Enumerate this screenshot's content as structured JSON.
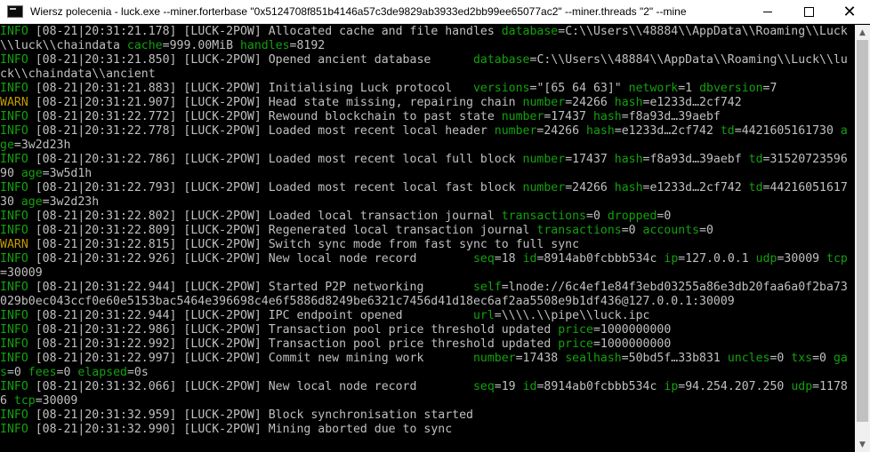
{
  "window": {
    "title": "Wiersz polecenia - luck.exe  --miner.forterbase \"0x5124708f851b4146a57c3de9829ab3933ed2bb99ee65077ac2\"  --miner.threads \"2\"  --mine",
    "controls": {
      "minimize": "—",
      "maximize": "☐",
      "close": "✕"
    }
  },
  "colors": {
    "info": "#13a10e",
    "warn": "#c19c00",
    "text": "#c0c0c0",
    "background": "#000000"
  },
  "lines": [
    [
      [
        "INFO",
        "INFO"
      ],
      [
        "t",
        " [08-21|20:31:21.178] [LUCK-2POW] Allocated cache and file handles "
      ],
      [
        "k",
        "database"
      ],
      [
        "t",
        "=C:\\\\Users\\\\48884\\\\AppData\\\\Roaming\\\\Luck"
      ]
    ],
    [
      [
        "t",
        "\\\\luck\\\\chaindata "
      ],
      [
        "k",
        "cache"
      ],
      [
        "t",
        "=999.00MiB "
      ],
      [
        "k",
        "handles"
      ],
      [
        "t",
        "=8192"
      ]
    ],
    [
      [
        "INFO",
        "INFO"
      ],
      [
        "t",
        " [08-21|20:31:21.850] [LUCK-2POW] Opened ancient database      "
      ],
      [
        "k",
        "database"
      ],
      [
        "t",
        "=C:\\\\Users\\\\48884\\\\AppData\\\\Roaming\\\\Luck\\\\lu"
      ]
    ],
    [
      [
        "t",
        "ck\\\\chaindata\\\\ancient"
      ]
    ],
    [
      [
        "INFO",
        "INFO"
      ],
      [
        "t",
        " [08-21|20:31:21.883] [LUCK-2POW] Initialising Luck protocol   "
      ],
      [
        "k",
        "versions"
      ],
      [
        "t",
        "=\"[65 64 63]\" "
      ],
      [
        "k",
        "network"
      ],
      [
        "t",
        "=1 "
      ],
      [
        "k",
        "dbversion"
      ],
      [
        "t",
        "=7"
      ]
    ],
    [
      [
        "WARN",
        "WARN"
      ],
      [
        "t",
        " [08-21|20:31:21.907] [LUCK-2POW] Head state missing, repairing chain "
      ],
      [
        "k",
        "number"
      ],
      [
        "t",
        "=24266 "
      ],
      [
        "k",
        "hash"
      ],
      [
        "t",
        "=e1233d…2cf742"
      ]
    ],
    [
      [
        "INFO",
        "INFO"
      ],
      [
        "t",
        " [08-21|20:31:22.772] [LUCK-2POW] Rewound blockchain to past state "
      ],
      [
        "k",
        "number"
      ],
      [
        "t",
        "=17437 "
      ],
      [
        "k",
        "hash"
      ],
      [
        "t",
        "=f8a93d…39aebf"
      ]
    ],
    [
      [
        "INFO",
        "INFO"
      ],
      [
        "t",
        " [08-21|20:31:22.778] [LUCK-2POW] Loaded most recent local header "
      ],
      [
        "k",
        "number"
      ],
      [
        "t",
        "=24266 "
      ],
      [
        "k",
        "hash"
      ],
      [
        "t",
        "=e1233d…2cf742 "
      ],
      [
        "k",
        "td"
      ],
      [
        "t",
        "=4421605161730 "
      ],
      [
        "k",
        "a"
      ]
    ],
    [
      [
        "k",
        "ge"
      ],
      [
        "t",
        "=3w2d23h"
      ]
    ],
    [
      [
        "INFO",
        "INFO"
      ],
      [
        "t",
        " [08-21|20:31:22.786] [LUCK-2POW] Loaded most recent local full block "
      ],
      [
        "k",
        "number"
      ],
      [
        "t",
        "=17437 "
      ],
      [
        "k",
        "hash"
      ],
      [
        "t",
        "=f8a93d…39aebf "
      ],
      [
        "k",
        "td"
      ],
      [
        "t",
        "=31520723596"
      ]
    ],
    [
      [
        "t",
        "90 "
      ],
      [
        "k",
        "age"
      ],
      [
        "t",
        "=3w5d1h"
      ]
    ],
    [
      [
        "INFO",
        "INFO"
      ],
      [
        "t",
        " [08-21|20:31:22.793] [LUCK-2POW] Loaded most recent local fast block "
      ],
      [
        "k",
        "number"
      ],
      [
        "t",
        "=24266 "
      ],
      [
        "k",
        "hash"
      ],
      [
        "t",
        "=e1233d…2cf742 "
      ],
      [
        "k",
        "td"
      ],
      [
        "t",
        "=44216051617"
      ]
    ],
    [
      [
        "t",
        "30 "
      ],
      [
        "k",
        "age"
      ],
      [
        "t",
        "=3w2d23h"
      ]
    ],
    [
      [
        "INFO",
        "INFO"
      ],
      [
        "t",
        " [08-21|20:31:22.802] [LUCK-2POW] Loaded local transaction journal "
      ],
      [
        "k",
        "transactions"
      ],
      [
        "t",
        "=0 "
      ],
      [
        "k",
        "dropped"
      ],
      [
        "t",
        "=0"
      ]
    ],
    [
      [
        "INFO",
        "INFO"
      ],
      [
        "t",
        " [08-21|20:31:22.809] [LUCK-2POW] Regenerated local transaction journal "
      ],
      [
        "k",
        "transactions"
      ],
      [
        "t",
        "=0 "
      ],
      [
        "k",
        "accounts"
      ],
      [
        "t",
        "=0"
      ]
    ],
    [
      [
        "WARN",
        "WARN"
      ],
      [
        "t",
        " [08-21|20:31:22.815] [LUCK-2POW] Switch sync mode from fast sync to full sync"
      ]
    ],
    [
      [
        "INFO",
        "INFO"
      ],
      [
        "t",
        " [08-21|20:31:22.926] [LUCK-2POW] New local node record        "
      ],
      [
        "k",
        "seq"
      ],
      [
        "t",
        "=18 "
      ],
      [
        "k",
        "id"
      ],
      [
        "t",
        "=8914ab0fcbbb534c "
      ],
      [
        "k",
        "ip"
      ],
      [
        "t",
        "=127.0.0.1 "
      ],
      [
        "k",
        "udp"
      ],
      [
        "t",
        "=30009 "
      ],
      [
        "k",
        "tcp"
      ]
    ],
    [
      [
        "t",
        "=30009"
      ]
    ],
    [
      [
        "INFO",
        "INFO"
      ],
      [
        "t",
        " [08-21|20:31:22.944] [LUCK-2POW] Started P2P networking       "
      ],
      [
        "k",
        "self"
      ],
      [
        "t",
        "=lnode://6c4ef1e84f3ebd03255a86e3db20faa6a0f2ba73"
      ]
    ],
    [
      [
        "t",
        "029b0ec043ccf0e60e5153bac5464e396698c4e6f5886d8249be6321c7456d41d18ec6af2aa5508e9b1df436@127.0.0.1:30009"
      ]
    ],
    [
      [
        "INFO",
        "INFO"
      ],
      [
        "t",
        " [08-21|20:31:22.944] [LUCK-2POW] IPC endpoint opened          "
      ],
      [
        "k",
        "url"
      ],
      [
        "t",
        "=\\\\\\\\.\\\\pipe\\\\luck.ipc"
      ]
    ],
    [
      [
        "INFO",
        "INFO"
      ],
      [
        "t",
        " [08-21|20:31:22.986] [LUCK-2POW] Transaction pool price threshold updated "
      ],
      [
        "k",
        "price"
      ],
      [
        "t",
        "=1000000000"
      ]
    ],
    [
      [
        "INFO",
        "INFO"
      ],
      [
        "t",
        " [08-21|20:31:22.992] [LUCK-2POW] Transaction pool price threshold updated "
      ],
      [
        "k",
        "price"
      ],
      [
        "t",
        "=1000000000"
      ]
    ],
    [
      [
        "INFO",
        "INFO"
      ],
      [
        "t",
        " [08-21|20:31:22.997] [LUCK-2POW] Commit new mining work       "
      ],
      [
        "k",
        "number"
      ],
      [
        "t",
        "=17438 "
      ],
      [
        "k",
        "sealhash"
      ],
      [
        "t",
        "=50bd5f…33b831 "
      ],
      [
        "k",
        "uncles"
      ],
      [
        "t",
        "=0 "
      ],
      [
        "k",
        "txs"
      ],
      [
        "t",
        "=0 "
      ],
      [
        "k",
        "ga"
      ]
    ],
    [
      [
        "k",
        "s"
      ],
      [
        "t",
        "=0 "
      ],
      [
        "k",
        "fees"
      ],
      [
        "t",
        "=0 "
      ],
      [
        "k",
        "elapsed"
      ],
      [
        "t",
        "=0s"
      ]
    ],
    [
      [
        "INFO",
        "INFO"
      ],
      [
        "t",
        " [08-21|20:31:32.066] [LUCK-2POW] New local node record        "
      ],
      [
        "k",
        "seq"
      ],
      [
        "t",
        "=19 "
      ],
      [
        "k",
        "id"
      ],
      [
        "t",
        "=8914ab0fcbbb534c "
      ],
      [
        "k",
        "ip"
      ],
      [
        "t",
        "=94.254.207.250 "
      ],
      [
        "k",
        "udp"
      ],
      [
        "t",
        "=1178"
      ]
    ],
    [
      [
        "t",
        "6 "
      ],
      [
        "k",
        "tcp"
      ],
      [
        "t",
        "=30009"
      ]
    ],
    [
      [
        "INFO",
        "INFO"
      ],
      [
        "t",
        " [08-21|20:31:32.959] [LUCK-2POW] Block synchronisation started"
      ]
    ],
    [
      [
        "INFO",
        "INFO"
      ],
      [
        "t",
        " [08-21|20:31:32.990] [LUCK-2POW] Mining aborted due to sync"
      ]
    ]
  ]
}
